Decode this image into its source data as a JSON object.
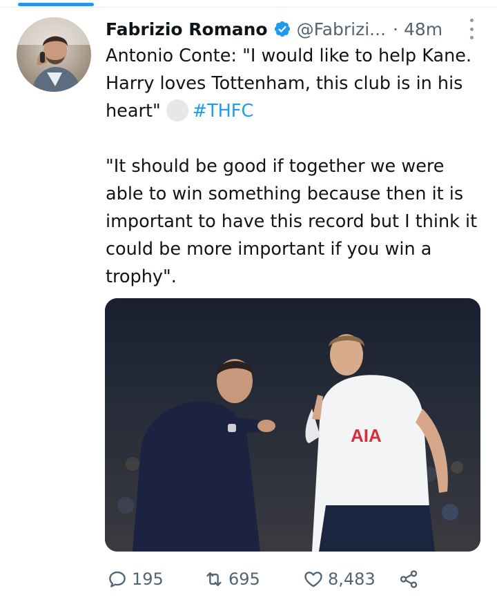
{
  "tweet": {
    "author_name": "Fabrizio Romano",
    "handle": "@Fabrizi...",
    "separator": "·",
    "time": "48m",
    "text_line1": "Antonio Conte: \"I would like to help Kane. Harry loves Tottenham, this club is in his heart\"",
    "hashtag": "#THFC",
    "quote": "\"It should be good if together we were able to win something because then it is important to have this record but I think it could be more important if you win a trophy\".",
    "media_caption_text": "AIA"
  },
  "actions": {
    "replies": "195",
    "retweets": "695",
    "likes": "8,483"
  },
  "icons": {
    "verified": "verified-badge-icon",
    "more": "more-options-icon",
    "reply": "reply-icon",
    "retweet": "retweet-icon",
    "like": "heart-icon",
    "share": "share-icon"
  },
  "colors": {
    "accent": "#1d9bf0",
    "text": "#0f1419",
    "secondary": "#536471"
  }
}
